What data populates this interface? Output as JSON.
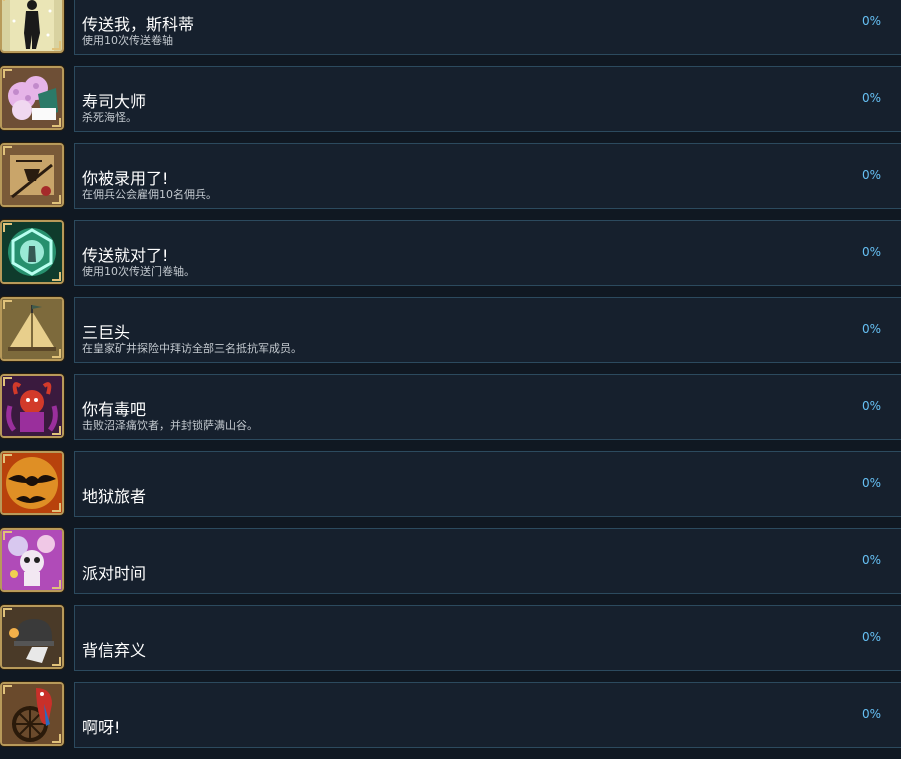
{
  "achievements": [
    {
      "title": "传送我，斯科蒂",
      "description": "使用10次传送卷轴",
      "percent": "0%",
      "icon": "silhouette-portal-icon",
      "colors": {
        "bg": "#d8d2a0",
        "fg": "#1a1a1a",
        "accent": "#f2edbf"
      }
    },
    {
      "title": "寿司大师",
      "description": "杀死海怪。",
      "percent": "0%",
      "icon": "sushi-icon",
      "colors": {
        "bg": "#6e4f36",
        "fg": "#e6b4e8",
        "accent": "#2c7a68"
      }
    },
    {
      "title": "你被录用了!",
      "description": "在佣兵公会雇佣10名佣兵。",
      "percent": "0%",
      "icon": "hiring-scroll-icon",
      "colors": {
        "bg": "#7a5a38",
        "fg": "#2a1c10",
        "accent": "#c9a56a"
      }
    },
    {
      "title": "传送就对了!",
      "description": "使用10次传送门卷轴。",
      "percent": "0%",
      "icon": "portal-icon",
      "colors": {
        "bg": "#0f3b2c",
        "fg": "#3fe6b0",
        "accent": "#b8fff0"
      }
    },
    {
      "title": "三巨头",
      "description": "在皇家矿井探险中拜访全部三名抵抗军成员。",
      "percent": "0%",
      "icon": "tent-icon",
      "colors": {
        "bg": "#7d6a3c",
        "fg": "#e8cf8c",
        "accent": "#3f5a4a"
      }
    },
    {
      "title": "你有毒吧",
      "description": "击败沼泽痛饮者，并封锁萨满山谷。",
      "percent": "0%",
      "icon": "poison-demon-icon",
      "colors": {
        "bg": "#3a1a3e",
        "fg": "#9a2f9c",
        "accent": "#d23a2a"
      }
    },
    {
      "title": "地狱旅者",
      "description": "",
      "percent": "0%",
      "icon": "hell-bats-icon",
      "colors": {
        "bg": "#b8420c",
        "fg": "#1a0f0a",
        "accent": "#ffcf3a"
      }
    },
    {
      "title": "派对时间",
      "description": "",
      "percent": "0%",
      "icon": "party-skull-icon",
      "colors": {
        "bg": "#b04bb8",
        "fg": "#f2e8f2",
        "accent": "#f0d050"
      }
    },
    {
      "title": "背信弃义",
      "description": "",
      "percent": "0%",
      "icon": "helmet-icon",
      "colors": {
        "bg": "#4a3a28",
        "fg": "#3a3a3a",
        "accent": "#e8e8e8"
      }
    },
    {
      "title": "啊呀!",
      "description": "",
      "percent": "0%",
      "icon": "parrot-wheel-icon",
      "colors": {
        "bg": "#6a4a2c",
        "fg": "#c9302a",
        "accent": "#2a6ac0"
      }
    }
  ]
}
